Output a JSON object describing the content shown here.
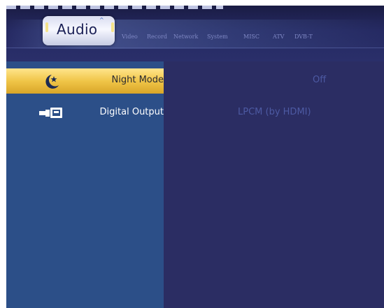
{
  "tabs": {
    "active": "Audio",
    "others": [
      "Video",
      "Record",
      "Network",
      "System",
      "MISC",
      "ATV",
      "DVB-T"
    ]
  },
  "settings": [
    {
      "label": "Night Mode",
      "value": "Off",
      "icon": "moon-star-icon",
      "selected": true
    },
    {
      "label": "Digital Output",
      "value": "LPCM (by HDMI)",
      "icon": "digital-output-connector-icon",
      "selected": false
    }
  ],
  "colors": {
    "selected_row": "#f0c548",
    "left_panel": "#2c4f88",
    "right_panel": "#2b2d63",
    "selected_label_text": "#2a2a30",
    "label_text": "#ffffff",
    "value_text": "#4d5aa3"
  }
}
